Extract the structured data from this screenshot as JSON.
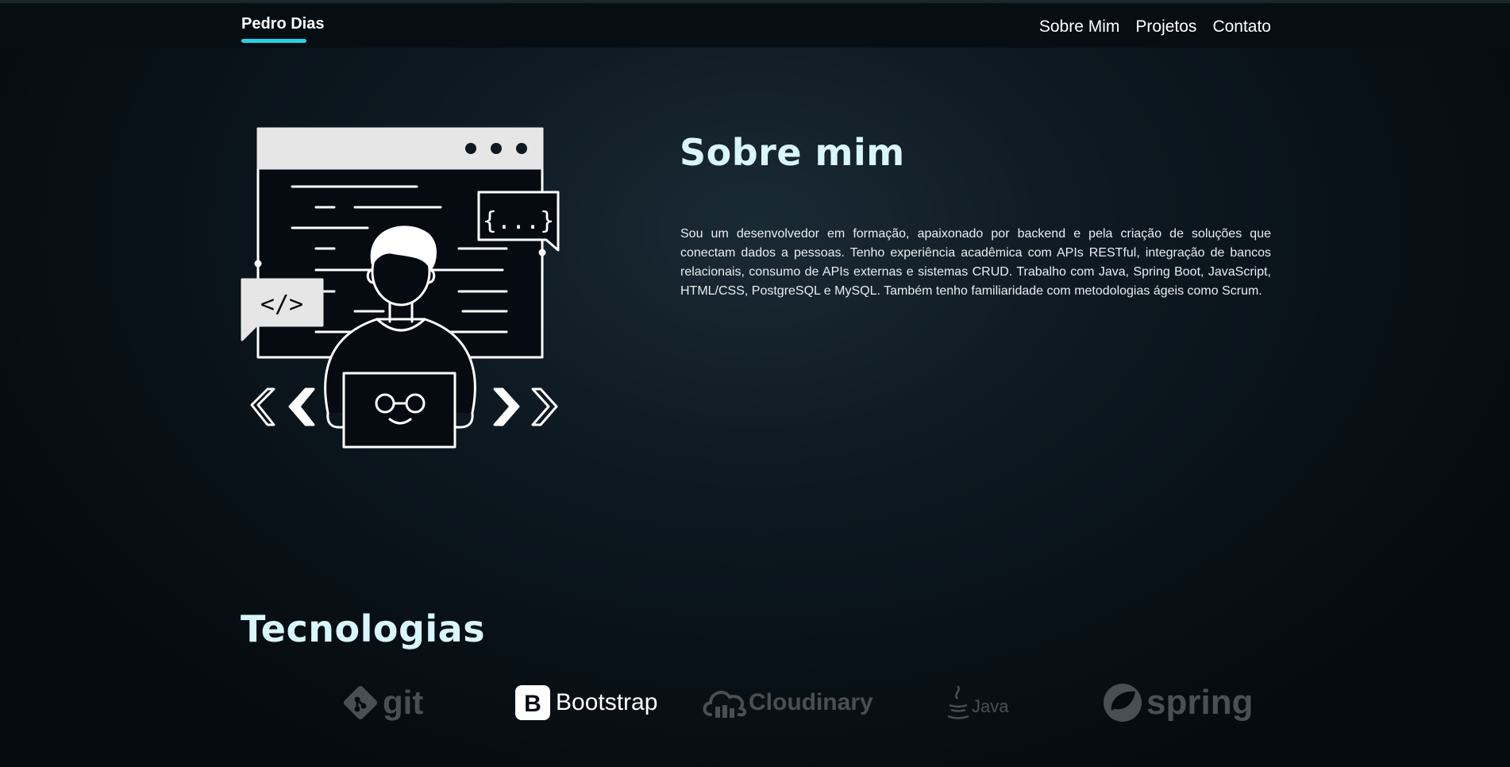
{
  "nav": {
    "brand": "Pedro Dias",
    "links": [
      "Sobre Mim",
      "Projetos",
      "Contato"
    ]
  },
  "about": {
    "title": "Sobre mim",
    "text": "Sou um desenvolvedor em formação, apaixonado por backend e pela criação de soluções que conectam dados a pessoas. Tenho experiência acadêmica com APIs RESTful, integração de bancos relacionais, consumo de APIs externas e sistemas CRUD. Trabalho com Java, Spring Boot, JavaScript, HTML/CSS, PostgreSQL e MySQL. Também tenho familiaridade com metodologias ágeis como Scrum."
  },
  "illustration": {
    "code_tag": "</>",
    "braces": "{...}"
  },
  "technologies": {
    "title": "Tecnologias",
    "items": [
      {
        "name": "git",
        "icon": "git-icon"
      },
      {
        "name": "Bootstrap",
        "icon": "bootstrap-icon"
      },
      {
        "name": "Cloudinary",
        "icon": "cloudinary-icon"
      },
      {
        "name": "Java",
        "icon": "java-icon"
      },
      {
        "name": "spring",
        "icon": "spring-icon"
      }
    ]
  },
  "colors": {
    "accent": "#22d3e6",
    "heading": "#d9f7fa",
    "background": "#0a141b"
  }
}
